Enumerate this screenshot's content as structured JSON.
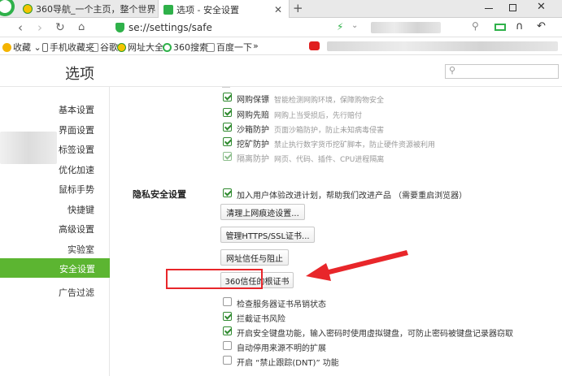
{
  "browser": {
    "tabs": [
      {
        "label": "360导航_一个主页，整个世界",
        "active": false
      },
      {
        "label": "选项 - 安全设置",
        "active": true
      }
    ],
    "new_tab_label": "+",
    "url": "se://settings/safe"
  },
  "bookmarks": [
    {
      "label": "收藏 ⌄",
      "icon": "star-icon"
    },
    {
      "label": "手机收藏夹",
      "icon": "phone-icon"
    },
    {
      "label": "谷歌",
      "icon": "page-icon"
    },
    {
      "label": "网址大全",
      "icon": "web-icon"
    },
    {
      "label": "360搜索",
      "icon": "search360-icon"
    },
    {
      "label": "百度一下",
      "icon": "page-icon"
    },
    {
      "label": "»",
      "icon": ""
    }
  ],
  "page": {
    "title": "选项",
    "search_placeholder": ""
  },
  "sidebar": {
    "items": [
      {
        "label": "基本设置"
      },
      {
        "label": "界面设置"
      },
      {
        "label": "标签设置"
      },
      {
        "label": "优化加速"
      },
      {
        "label": "鼠标手势"
      },
      {
        "label": "快捷键"
      },
      {
        "label": "高级设置"
      },
      {
        "label": "实验室"
      },
      {
        "label": "安全设置",
        "active": true
      },
      {
        "label": "广告过滤"
      }
    ]
  },
  "security": {
    "top_options": [
      {
        "label": "网购保镖",
        "desc": "智能检测网购环境，保障购物安全",
        "checked": true
      },
      {
        "label": "网购先赔",
        "desc": "网购上当受损后，先行赔付",
        "checked": true
      },
      {
        "label": "沙箱防护",
        "desc": "页面沙箱防护，防止未知病毒侵害",
        "checked": true
      },
      {
        "label": "挖矿防护",
        "desc": "禁止执行数字货币挖矿脚本，防止硬件资源被利用",
        "checked": true
      },
      {
        "label": "隔离防护",
        "desc": "网页、代码、插件、CPU进程隔离",
        "checked": true,
        "disabled": true
      }
    ],
    "privacy_heading": "隐私安全设置",
    "experience_plan": {
      "label": "加入用户体验改进计划，帮助我们改进产品 （需要重启浏览器）",
      "checked": true
    },
    "buttons": [
      {
        "label": "清理上网痕迹设置..."
      },
      {
        "label": "管理HTTPS/SSL证书..."
      },
      {
        "label": "网址信任与阻止"
      },
      {
        "label": "360信任的根证书"
      }
    ],
    "bottom_options": [
      {
        "label": "检查服务器证书吊销状态",
        "checked": false
      },
      {
        "label": "拦截证书风险",
        "checked": true
      },
      {
        "label": "开启安全键盘功能，输入密码时使用虚拟键盘，可防止密码被键盘记录器窃取",
        "checked": true
      },
      {
        "label": "自动停用来源不明的扩展",
        "checked": false
      },
      {
        "label": "开启 “禁止跟踪(DNT)” 功能",
        "checked": false
      }
    ]
  },
  "colors": {
    "accent": "#5cb531",
    "annotation_red": "#e8262a"
  }
}
